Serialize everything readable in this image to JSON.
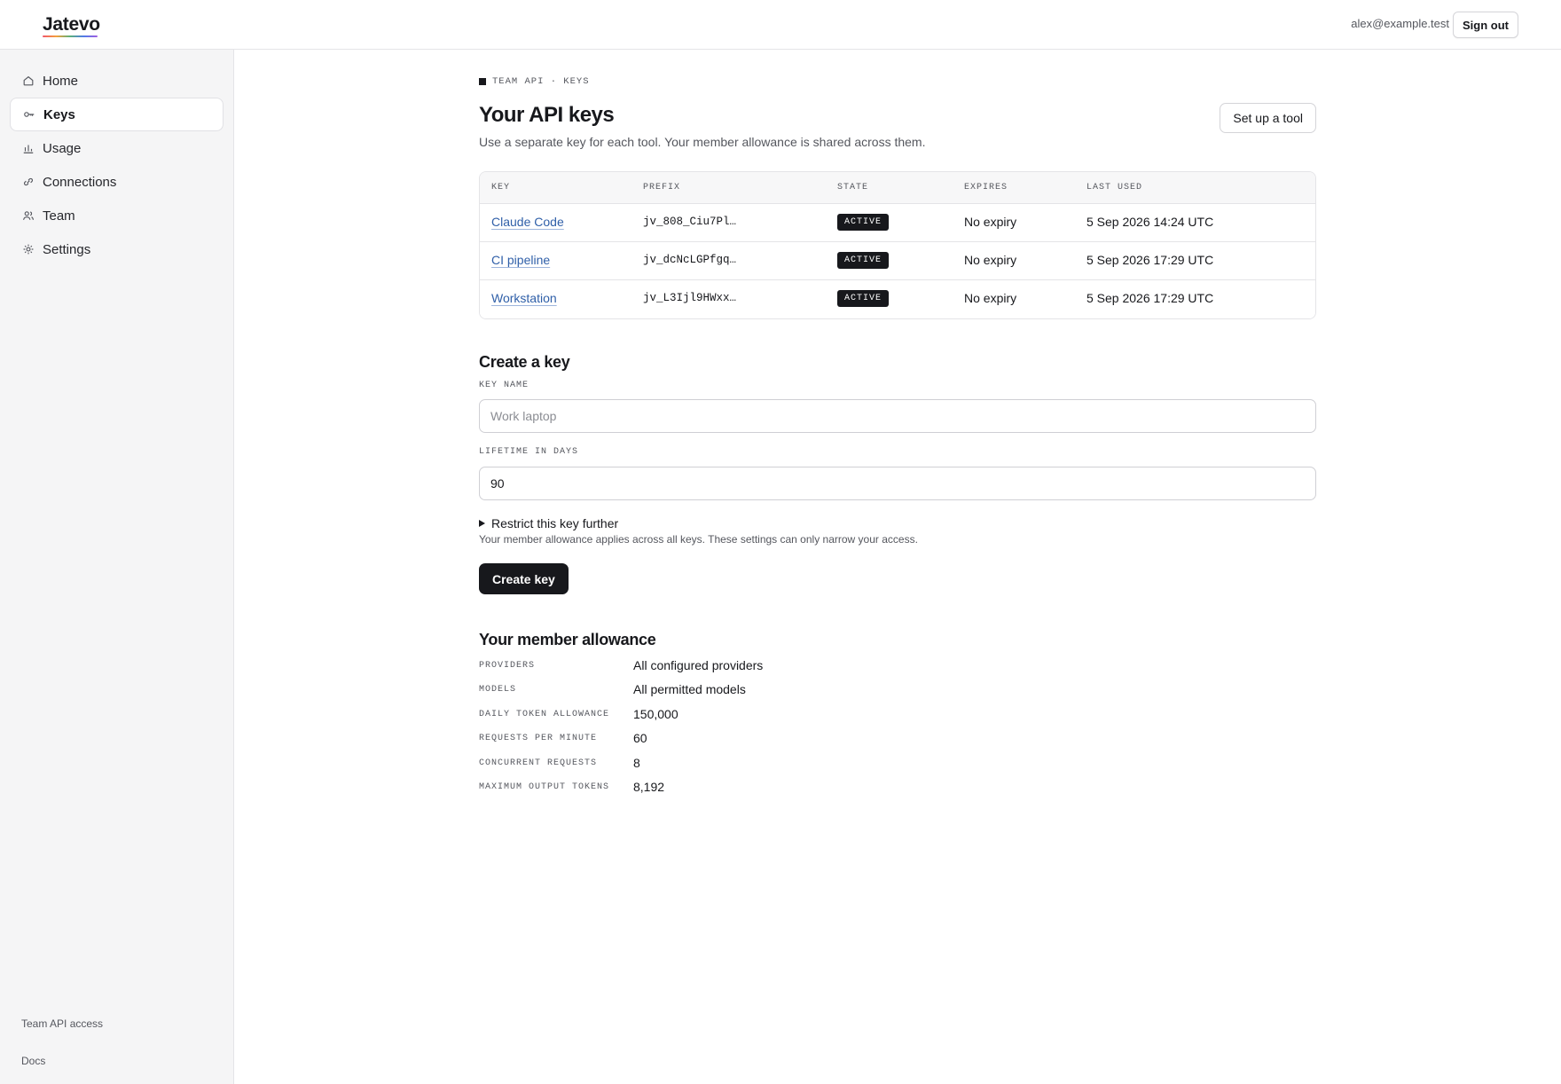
{
  "header": {
    "logo": "Jatevo",
    "user_email": "alex@example.test",
    "sign_out_label": "Sign out"
  },
  "sidebar": {
    "items": [
      {
        "label": "Home",
        "icon": "home-icon",
        "active": false
      },
      {
        "label": "Keys",
        "icon": "key-icon",
        "active": true
      },
      {
        "label": "Usage",
        "icon": "bar-chart-icon",
        "active": false
      },
      {
        "label": "Connections",
        "icon": "link-icon",
        "active": false
      },
      {
        "label": "Team",
        "icon": "users-icon",
        "active": false
      },
      {
        "label": "Settings",
        "icon": "gear-icon",
        "active": false
      }
    ],
    "footer": {
      "team_api_access": "Team API access",
      "docs": "Docs"
    }
  },
  "main": {
    "breadcrumb": "TEAM API · KEYS",
    "title": "Your API keys",
    "subtitle": "Use a separate key for each tool. Your member allowance is shared across them.",
    "setup_button_label": "Set up a tool",
    "table": {
      "columns": [
        "KEY",
        "PREFIX",
        "STATE",
        "EXPIRES",
        "LAST USED"
      ],
      "rows": [
        {
          "key": "Claude Code",
          "prefix": "jv_808_Ciu7Pl…",
          "state": "ACTIVE",
          "expires": "No expiry",
          "last_used": "5 Sep 2026 14:24 UTC"
        },
        {
          "key": "CI pipeline",
          "prefix": "jv_dcNcLGPfgq…",
          "state": "ACTIVE",
          "expires": "No expiry",
          "last_used": "5 Sep 2026 17:29 UTC"
        },
        {
          "key": "Workstation",
          "prefix": "jv_L3Ijl9HWxx…",
          "state": "ACTIVE",
          "expires": "No expiry",
          "last_used": "5 Sep 2026 17:29 UTC"
        }
      ]
    },
    "create": {
      "title": "Create a key",
      "key_name_label": "KEY NAME",
      "key_name_placeholder": "Work laptop",
      "key_name_value": "",
      "lifetime_label": "LIFETIME IN DAYS",
      "lifetime_value": "90",
      "restrict_label": "Restrict this key further",
      "restrict_note": "Your member allowance applies across all keys. These settings can only narrow your access.",
      "create_button_label": "Create key"
    },
    "allowance": {
      "title": "Your member allowance",
      "rows": [
        {
          "label": "PROVIDERS",
          "value": "All configured providers"
        },
        {
          "label": "MODELS",
          "value": "All permitted models"
        },
        {
          "label": "DAILY TOKEN ALLOWANCE",
          "value": "150,000"
        },
        {
          "label": "REQUESTS PER MINUTE",
          "value": "60"
        },
        {
          "label": "CONCURRENT REQUESTS",
          "value": "8"
        },
        {
          "label": "MAXIMUM OUTPUT TOKENS",
          "value": "8,192"
        }
      ]
    }
  },
  "colors": {
    "accent": "#17181c",
    "link": "#2f5fa8",
    "sidebar_bg": "#f5f5f6",
    "border": "#e4e4e7"
  }
}
